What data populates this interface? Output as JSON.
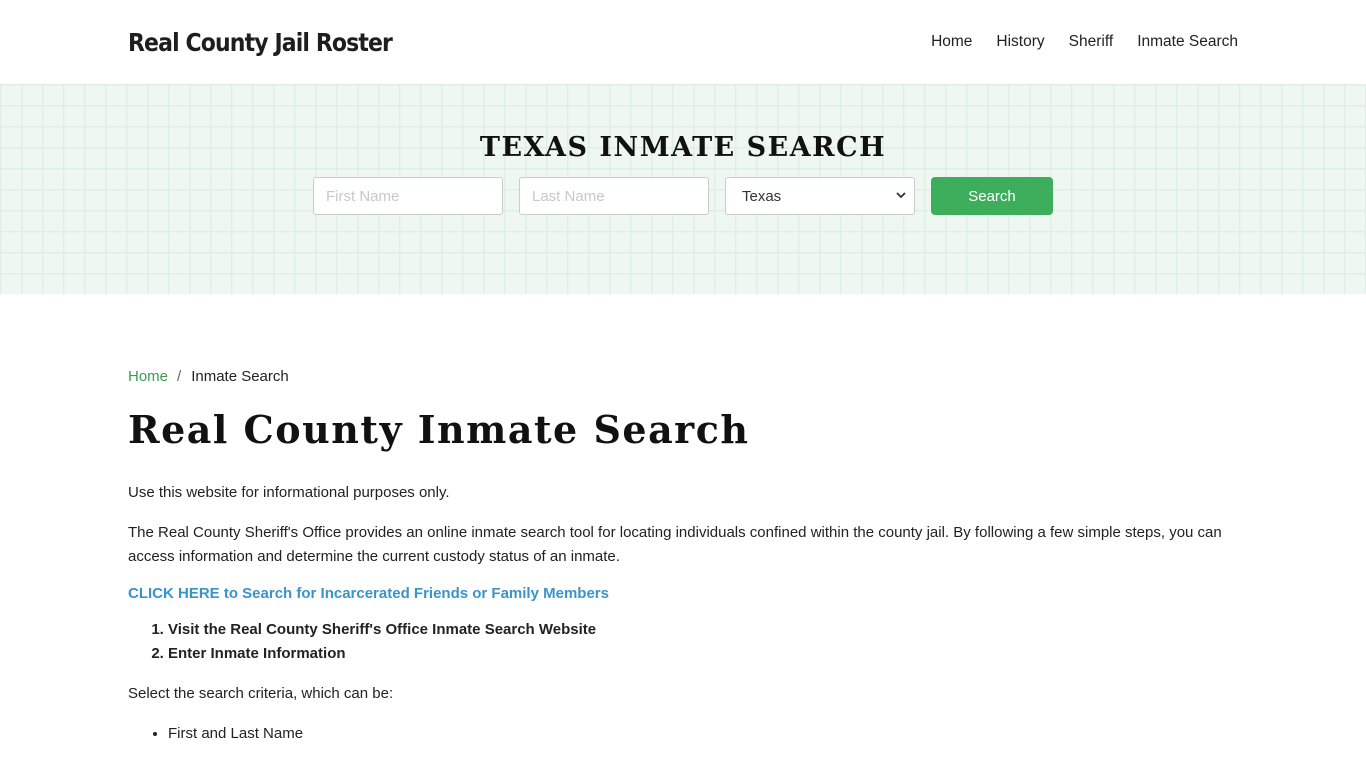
{
  "header": {
    "brand": "Real County Jail Roster",
    "nav": [
      {
        "label": "Home"
      },
      {
        "label": "History"
      },
      {
        "label": "Sheriff"
      },
      {
        "label": "Inmate Search"
      }
    ]
  },
  "hero": {
    "title": "TEXAS INMATE SEARCH",
    "first_name_placeholder": "First Name",
    "last_name_placeholder": "Last Name",
    "state_selected": "Texas",
    "search_label": "Search"
  },
  "breadcrumb": {
    "home": "Home",
    "separator": "/",
    "current": "Inmate Search"
  },
  "main": {
    "title": "Real County Inmate Search",
    "intro": "Use this website for informational purposes only.",
    "description": "The Real County Sheriff's Office provides an online inmate search tool for locating individuals confined within the county jail. By following a few simple steps, you can access information and determine the current custody status of an inmate.",
    "cta": "CLICK HERE to Search for Incarcerated Friends or Family Members",
    "steps": [
      "Visit the Real County Sheriff's Office Inmate Search Website",
      "Enter Inmate Information"
    ],
    "criteria_intro": "Select the search criteria, which can be:",
    "criteria": [
      "First and Last Name"
    ]
  },
  "colors": {
    "accent_green": "#3cae5c",
    "link_green": "#3a9a54",
    "link_blue": "#3a94c9",
    "hero_bg": "#eef8f1"
  }
}
